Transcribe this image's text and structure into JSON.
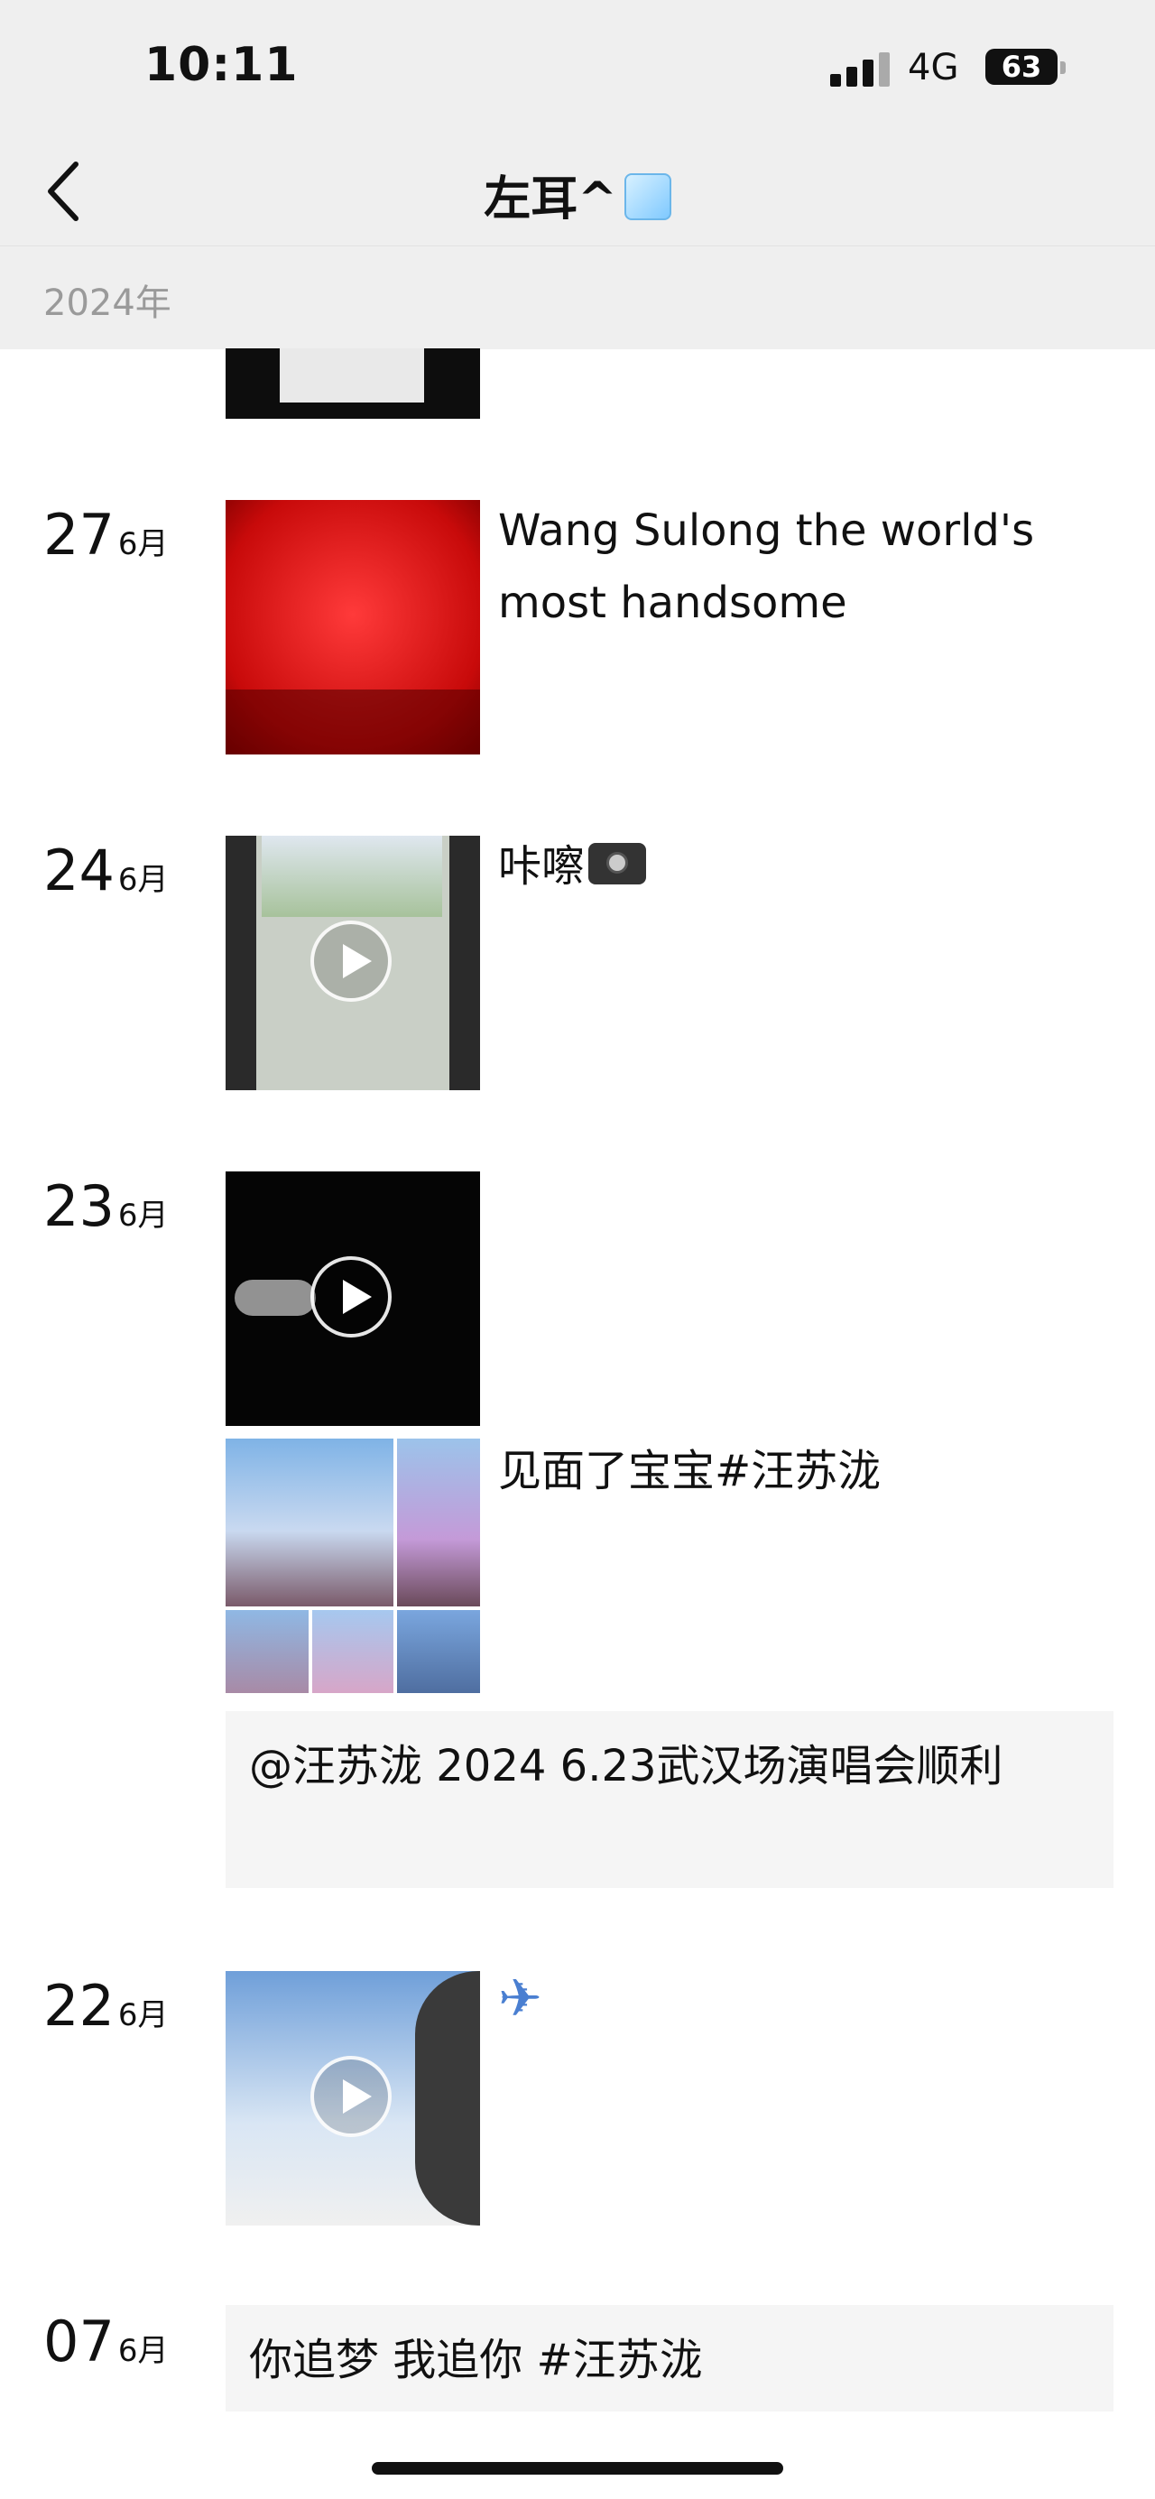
{
  "status": {
    "time": "10:11",
    "network": "4G",
    "battery": "63"
  },
  "header": {
    "title": "左耳^"
  },
  "year_label": "2024年",
  "posts": [
    {
      "day": "27",
      "month": "6月",
      "caption": "Wang Sulong the world's most handsome"
    },
    {
      "day": "24",
      "month": "6月",
      "caption": "咔嚓"
    },
    {
      "day": "23",
      "month": "6月",
      "caption": "见面了宝宝#汪苏泷",
      "quote": "@汪苏泷 2024 6.23武汉场演唱会顺利"
    },
    {
      "day": "22",
      "month": "6月"
    },
    {
      "day": "07",
      "month": "6月",
      "quote": "你追梦 我追你 #汪苏泷"
    }
  ],
  "icons": {
    "back": "chevron-left-icon",
    "title_emoji": "ice-cube-icon",
    "camera": "camera-icon",
    "plane": "airplane-icon",
    "play": "play-icon"
  }
}
